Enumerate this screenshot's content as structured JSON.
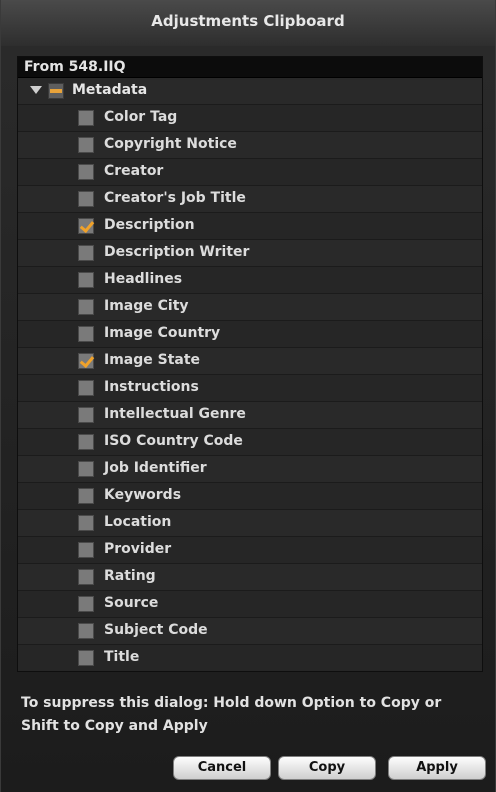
{
  "window": {
    "title": "Adjustments Clipboard"
  },
  "panel": {
    "header": "From 548.IIQ",
    "group": {
      "label": "Metadata",
      "state": "mixed"
    },
    "items": [
      {
        "label": "Color Tag",
        "checked": false
      },
      {
        "label": "Copyright Notice",
        "checked": false
      },
      {
        "label": "Creator",
        "checked": false
      },
      {
        "label": "Creator's Job Title",
        "checked": false
      },
      {
        "label": "Description",
        "checked": true
      },
      {
        "label": "Description Writer",
        "checked": false
      },
      {
        "label": "Headlines",
        "checked": false
      },
      {
        "label": "Image City",
        "checked": false
      },
      {
        "label": "Image Country",
        "checked": false
      },
      {
        "label": "Image State",
        "checked": true
      },
      {
        "label": "Instructions",
        "checked": false
      },
      {
        "label": "Intellectual Genre",
        "checked": false
      },
      {
        "label": "ISO Country Code",
        "checked": false
      },
      {
        "label": "Job Identifier",
        "checked": false
      },
      {
        "label": "Keywords",
        "checked": false
      },
      {
        "label": "Location",
        "checked": false
      },
      {
        "label": "Provider",
        "checked": false
      },
      {
        "label": "Rating",
        "checked": false
      },
      {
        "label": "Source",
        "checked": false
      },
      {
        "label": "Subject Code",
        "checked": false
      },
      {
        "label": "Title",
        "checked": false
      }
    ]
  },
  "footer": {
    "hint": "To suppress this dialog: Hold down Option to Copy or Shift to Copy and Apply"
  },
  "buttons": {
    "cancel": "Cancel",
    "copy": "Copy",
    "apply": "Apply"
  },
  "colors": {
    "accent": "#f0a22a",
    "background": "#1e1e1e"
  }
}
